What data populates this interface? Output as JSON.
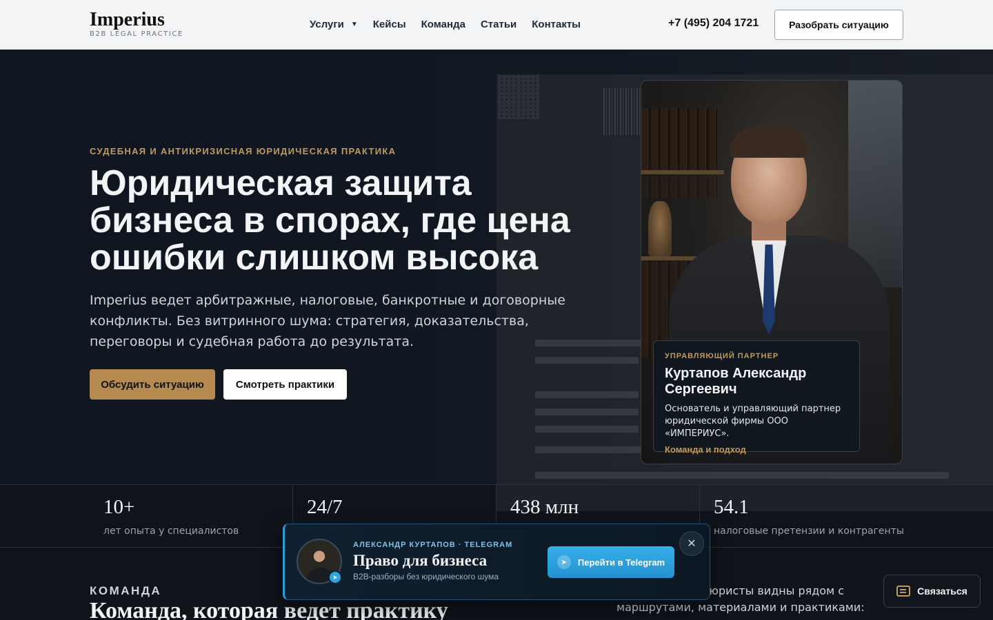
{
  "header": {
    "logo_name": "Imperius",
    "logo_sub": "B2B LEGAL PRACTICE",
    "nav": [
      {
        "label": "Услуги",
        "has_dropdown": true,
        "icon": "chevron-down-icon"
      },
      {
        "label": "Кейсы"
      },
      {
        "label": "Команда"
      },
      {
        "label": "Статьи"
      },
      {
        "label": "Контакты"
      }
    ],
    "phone": "+7 (495) 204 1721",
    "cta": "Разобрать ситуацию"
  },
  "hero": {
    "eyebrow": "СУДЕБНАЯ И АНТИКРИЗИСНАЯ ЮРИДИЧЕСКАЯ ПРАКТИКА",
    "title": "Юридическая защита бизнеса в спорах, где цена ошибки слишком высока",
    "lead": "Imperius ведет арбитражные, налоговые, банкротные и договорные конфликты. Без витринного шума: стратегия, доказательства, переговоры и судебная работа до результата.",
    "btn_primary": "Обсудить ситуацию",
    "btn_secondary": "Смотреть практики"
  },
  "partner": {
    "role": "УПРАВЛЯЮЩИЙ ПАРТНЕР",
    "name": "Куртапов Александр Сергеевич",
    "description": "Основатель и управляющий партнер юридической фирмы ООО «ИМПЕРИУС».",
    "link": "Команда и подход"
  },
  "stats": [
    {
      "value": "10+",
      "label": "лет опыта у специалистов"
    },
    {
      "value": "24/7",
      "label": ""
    },
    {
      "value": "438 млн",
      "label": ""
    },
    {
      "value": "54.1",
      "label": "налоговые претензии и контрагенты"
    }
  ],
  "team_section": {
    "eyebrow": "КОМАНДА",
    "title": "Команда, которая ведет практику",
    "text": "Специалисты и юристы видны рядом с маршрутами, материалами и практиками: клиент"
  },
  "telegram_popup": {
    "meta": "АЛЕКСАНДР КУРТАПОВ · TELEGRAM",
    "title": "Право для бизнеса",
    "subtitle": "B2B-разборы без юридического шума",
    "button": "Перейти в Telegram",
    "close": "✕"
  },
  "contact_button": "Связаться",
  "colors": {
    "accent_gold": "#c29a5b",
    "button_gold": "#b48a4f",
    "telegram_blue": "#2a9fd6",
    "hero_bg": "#0f1620"
  }
}
